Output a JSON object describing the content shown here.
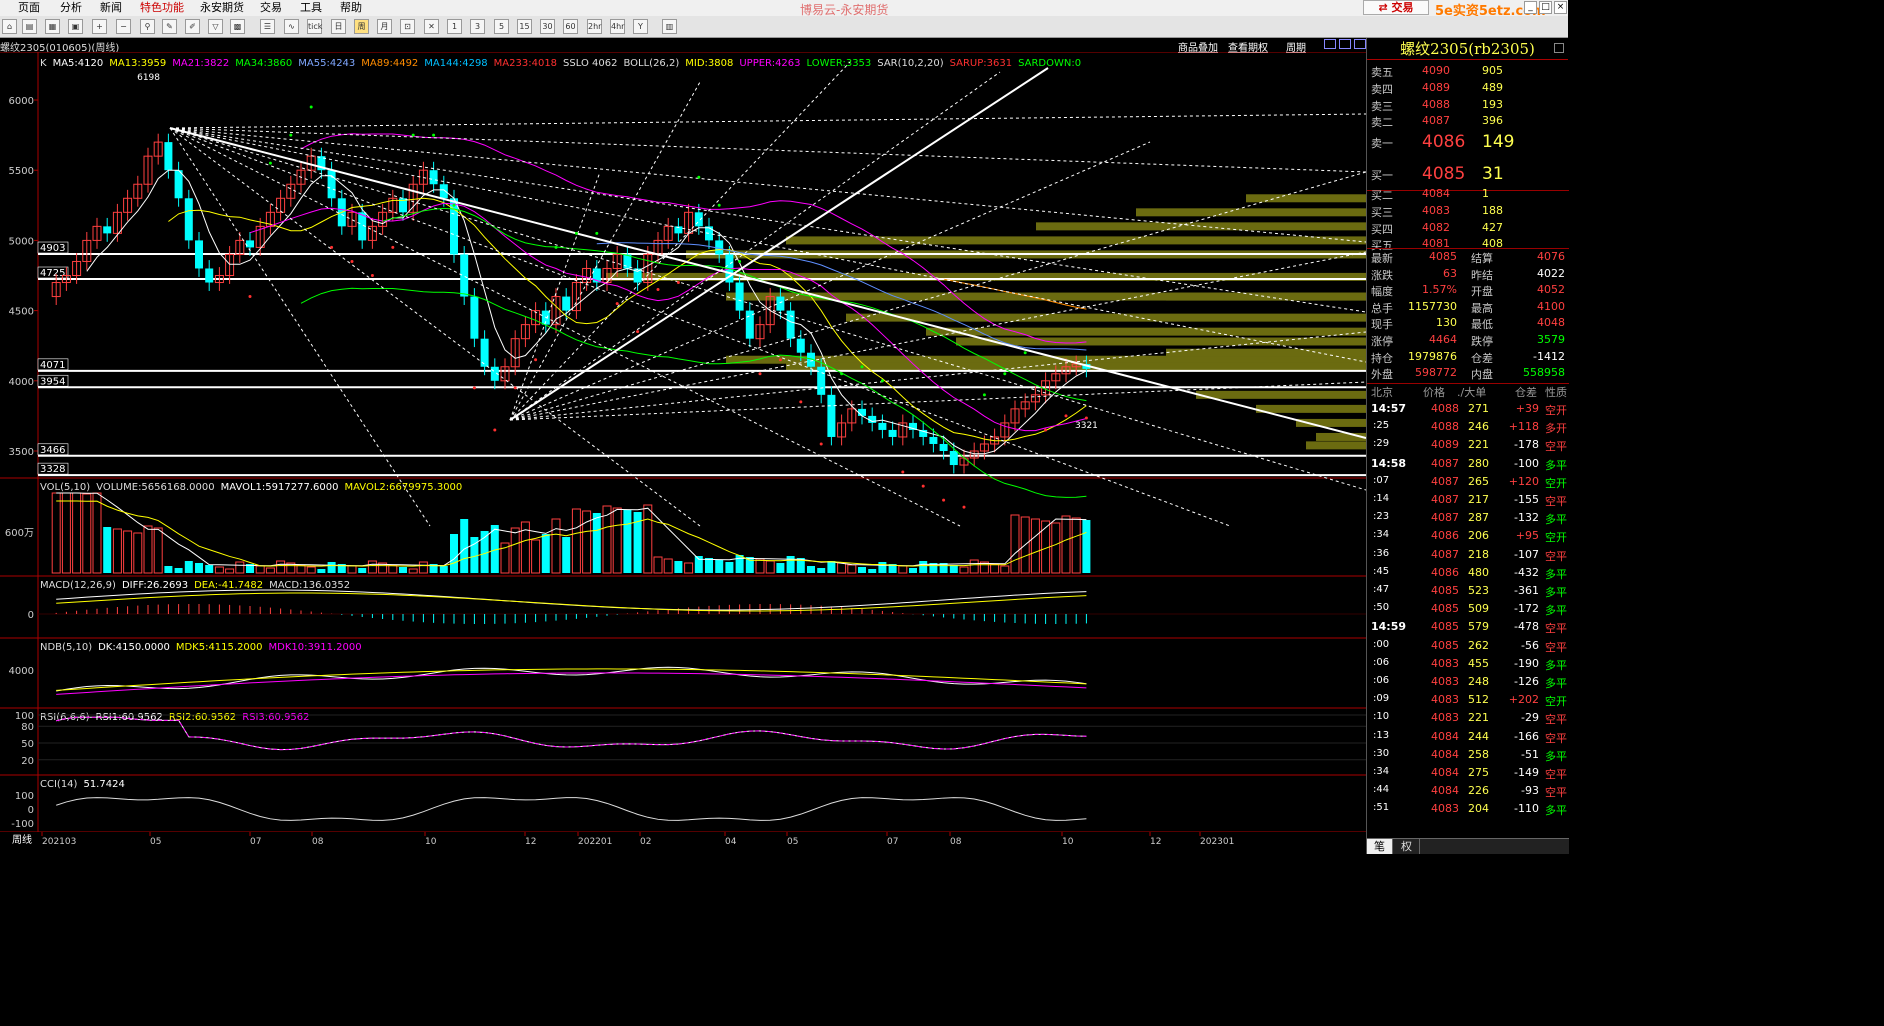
{
  "menu": [
    "页面",
    "分析",
    "新闻",
    "特色功能",
    "永安期货",
    "交易",
    "工具",
    "帮助"
  ],
  "app_title": "博易云-永安期货",
  "trade_label": "交易",
  "watermark": "5e实资5etz.com",
  "toolbar_labels": [
    "tick",
    "日",
    "周",
    "月",
    "1",
    "3",
    "5",
    "15",
    "30",
    "60",
    "2hr",
    "4hr",
    "Y"
  ],
  "chart_title": "螺纹2305(010605)(周线)",
  "top_links": [
    "商品叠加",
    "查看期权",
    "周期"
  ],
  "colors": {
    "up": "#ff4040",
    "down": "#00ffff",
    "ma5": "#ffffff",
    "ma13": "#ffff00",
    "ma21": "#ff00ff",
    "ma34": "#00ff00",
    "ma55": "#5f8fff",
    "ma89": "#ff8c00",
    "ma144": "#00bfff",
    "ma233": "#ff3030",
    "vol_bar": "#ff4040"
  },
  "indicator_line": [
    {
      "t": "K",
      "c": "#dddddd"
    },
    {
      "t": "MA5:4120",
      "c": "#ffffff"
    },
    {
      "t": "MA13:3959",
      "c": "#ffff00"
    },
    {
      "t": "MA21:3822",
      "c": "#ff00ff"
    },
    {
      "t": "MA34:3860",
      "c": "#00ff00"
    },
    {
      "t": "MA55:4243",
      "c": "#7fa7ff"
    },
    {
      "t": "MA89:4492",
      "c": "#ff8c00"
    },
    {
      "t": "MA144:4298",
      "c": "#00bfff"
    },
    {
      "t": "MA233:4018",
      "c": "#ff3030"
    },
    {
      "t": "SSLO 4062",
      "c": "#dddddd"
    },
    {
      "t": "BOLL(26,2)",
      "c": "#dddddd"
    },
    {
      "t": "MID:3808",
      "c": "#ffff00"
    },
    {
      "t": "UPPER:4263",
      "c": "#ff00ff"
    },
    {
      "t": "LOWER:3353",
      "c": "#00ff00"
    },
    {
      "t": "SAR(10,2,20)",
      "c": "#dddddd"
    },
    {
      "t": "SARUP:3631",
      "c": "#ff3030"
    },
    {
      "t": "SARDOWN:0",
      "c": "#00ff00"
    }
  ],
  "price_axis": [
    {
      "v": 6000,
      "label": "6000"
    },
    {
      "v": 5500,
      "label": "5500"
    },
    {
      "v": 5000,
      "label": "5000"
    },
    {
      "v": 4500,
      "label": "4500"
    },
    {
      "v": 4000,
      "label": "4000"
    },
    {
      "v": 3500,
      "label": "3500"
    }
  ],
  "h_levels": [
    "4903",
    "4725",
    "4071",
    "3954",
    "3466",
    "3328"
  ],
  "high_label": "6198",
  "low_label": "3321",
  "vol_header": [
    {
      "t": "VOL(5,10)",
      "c": "#dddddd"
    },
    {
      "t": "VOLUME:5656168.0000",
      "c": "#dddddd"
    },
    {
      "t": "MAVOL1:5917277.6000",
      "c": "#ffffff"
    },
    {
      "t": "MAVOL2:6679975.3000",
      "c": "#ffff00"
    }
  ],
  "vol_axis": "600万",
  "macd_header": [
    {
      "t": "MACD(12,26,9)",
      "c": "#dddddd"
    },
    {
      "t": "DIFF:26.2693",
      "c": "#ffffff"
    },
    {
      "t": "DEA:-41.7482",
      "c": "#ffff00"
    },
    {
      "t": "MACD:136.0352",
      "c": "#dddddd"
    }
  ],
  "macd_axis": "0",
  "ndb_header": [
    {
      "t": "NDB(5,10)",
      "c": "#dddddd"
    },
    {
      "t": "DK:4150.0000",
      "c": "#ffffff"
    },
    {
      "t": "MDK5:4115.2000",
      "c": "#ffff00"
    },
    {
      "t": "MDK10:3911.2000",
      "c": "#ff00ff"
    }
  ],
  "ndb_axis": "4000",
  "rsi_header": [
    {
      "t": "RSI(6,6,6)",
      "c": "#dddddd"
    },
    {
      "t": "RSI1:60.9562",
      "c": "#ffffff"
    },
    {
      "t": "RSI2:60.9562",
      "c": "#ffff00"
    },
    {
      "t": "RSI3:60.9562",
      "c": "#ff00ff"
    }
  ],
  "rsi_axis": [
    "100",
    "80",
    "50",
    "20"
  ],
  "cci_header": [
    {
      "t": "CCI(14)",
      "c": "#dddddd"
    },
    {
      "t": "51.7424",
      "c": "#ffffff"
    }
  ],
  "cci_axis": [
    "100",
    "0",
    "-100"
  ],
  "period_label": "周线",
  "date_axis": [
    "202103",
    "05",
    "07",
    "08",
    "10",
    "12",
    "202201",
    "02",
    "04",
    "05",
    "07",
    "08",
    "10",
    "12",
    "202301"
  ],
  "bottom_status": "...",
  "quote": {
    "title": "螺纹2305(rb2305)",
    "asks": [
      {
        "l": "卖五",
        "p": "4090",
        "v": "905"
      },
      {
        "l": "卖四",
        "p": "4089",
        "v": "489"
      },
      {
        "l": "卖三",
        "p": "4088",
        "v": "193"
      },
      {
        "l": "卖二",
        "p": "4087",
        "v": "396"
      },
      {
        "l": "卖一",
        "p": "4086",
        "v": "149"
      }
    ],
    "bids": [
      {
        "l": "买一",
        "p": "4085",
        "v": "31"
      },
      {
        "l": "买二",
        "p": "4084",
        "v": "1"
      },
      {
        "l": "买三",
        "p": "4083",
        "v": "188"
      },
      {
        "l": "买四",
        "p": "4082",
        "v": "427"
      },
      {
        "l": "买五",
        "p": "4081",
        "v": "408"
      }
    ],
    "stats": [
      {
        "l1": "最新",
        "v1": "4085",
        "c1": "#ff4040",
        "l2": "结算",
        "v2": "4076",
        "c2": "#ff4040"
      },
      {
        "l1": "涨跌",
        "v1": "63",
        "c1": "#ff4040",
        "l2": "昨结",
        "v2": "4022",
        "c2": "#ffffff"
      },
      {
        "l1": "幅度",
        "v1": "1.57%",
        "c1": "#ff4040",
        "l2": "开盘",
        "v2": "4052",
        "c2": "#ff4040"
      },
      {
        "l1": "总手",
        "v1": "1157730",
        "c1": "#ffff50",
        "l2": "最高",
        "v2": "4100",
        "c2": "#ff4040"
      },
      {
        "l1": "现手",
        "v1": "130",
        "c1": "#ffff50",
        "l2": "最低",
        "v2": "4048",
        "c2": "#ff4040"
      },
      {
        "l1": "涨停",
        "v1": "4464",
        "c1": "#ff4040",
        "l2": "跌停",
        "v2": "3579",
        "c2": "#00ff00"
      },
      {
        "l1": "持仓",
        "v1": "1979876",
        "c1": "#ffff50",
        "l2": "仓差",
        "v2": "-1412",
        "c2": "#ffffff"
      },
      {
        "l1": "外盘",
        "v1": "598772",
        "c1": "#ff4040",
        "l2": "内盘",
        "v2": "558958",
        "c2": "#00ff00"
      }
    ],
    "tick_header": [
      "北京",
      "价格",
      "./大单",
      "仓差",
      "性质"
    ],
    "ticks": [
      {
        "t": "14:57",
        "p": "4088",
        "v": "271",
        "d": "+39",
        "n": "空开",
        "nc": "#ff4040",
        "bold": true
      },
      {
        "t": ":25",
        "p": "4088",
        "v": "246",
        "d": "+118",
        "n": "多开",
        "nc": "#ff4040"
      },
      {
        "t": ":29",
        "p": "4089",
        "v": "221",
        "d": "-178",
        "n": "空平",
        "nc": "#ff4040"
      },
      {
        "t": "14:58",
        "p": "4087",
        "v": "280",
        "d": "-100",
        "n": "多平",
        "nc": "#00ff00",
        "bold": true
      },
      {
        "t": ":07",
        "p": "4087",
        "v": "265",
        "d": "+120",
        "n": "空开",
        "nc": "#00ff00"
      },
      {
        "t": ":14",
        "p": "4087",
        "v": "217",
        "d": "-155",
        "n": "空平",
        "nc": "#ff4040"
      },
      {
        "t": ":23",
        "p": "4087",
        "v": "287",
        "d": "-132",
        "n": "多平",
        "nc": "#00ff00"
      },
      {
        "t": ":34",
        "p": "4086",
        "v": "206",
        "d": "+95",
        "n": "空开",
        "nc": "#00ff00"
      },
      {
        "t": ":36",
        "p": "4087",
        "v": "218",
        "d": "-107",
        "n": "空平",
        "nc": "#ff4040"
      },
      {
        "t": ":45",
        "p": "4086",
        "v": "480",
        "d": "-432",
        "n": "多平",
        "nc": "#00ff00"
      },
      {
        "t": ":47",
        "p": "4085",
        "v": "523",
        "d": "-361",
        "n": "多平",
        "nc": "#00ff00"
      },
      {
        "t": ":50",
        "p": "4085",
        "v": "509",
        "d": "-172",
        "n": "多平",
        "nc": "#00ff00"
      },
      {
        "t": "14:59",
        "p": "4085",
        "v": "579",
        "d": "-478",
        "n": "空平",
        "nc": "#ff4040",
        "bold": true
      },
      {
        "t": ":00",
        "p": "4085",
        "v": "262",
        "d": "-56",
        "n": "空平",
        "nc": "#ff4040"
      },
      {
        "t": ":06",
        "p": "4083",
        "v": "455",
        "d": "-190",
        "n": "多平",
        "nc": "#00ff00"
      },
      {
        "t": ":06",
        "p": "4083",
        "v": "248",
        "d": "-126",
        "n": "多平",
        "nc": "#00ff00"
      },
      {
        "t": ":09",
        "p": "4083",
        "v": "512",
        "d": "+202",
        "n": "空开",
        "nc": "#00ff00"
      },
      {
        "t": ":10",
        "p": "4083",
        "v": "221",
        "d": "-29",
        "n": "空平",
        "nc": "#ff4040"
      },
      {
        "t": ":13",
        "p": "4084",
        "v": "244",
        "d": "-166",
        "n": "空平",
        "nc": "#ff4040"
      },
      {
        "t": ":30",
        "p": "4084",
        "v": "258",
        "d": "-51",
        "n": "多平",
        "nc": "#00ff00"
      },
      {
        "t": ":34",
        "p": "4084",
        "v": "275",
        "d": "-149",
        "n": "空平",
        "nc": "#ff4040"
      },
      {
        "t": ":44",
        "p": "4084",
        "v": "226",
        "d": "-93",
        "n": "空平",
        "nc": "#ff4040"
      },
      {
        "t": ":51",
        "p": "4083",
        "v": "204",
        "d": "-110",
        "n": "多平",
        "nc": "#00ff00"
      }
    ],
    "tabs": [
      "笔",
      "权"
    ]
  }
}
